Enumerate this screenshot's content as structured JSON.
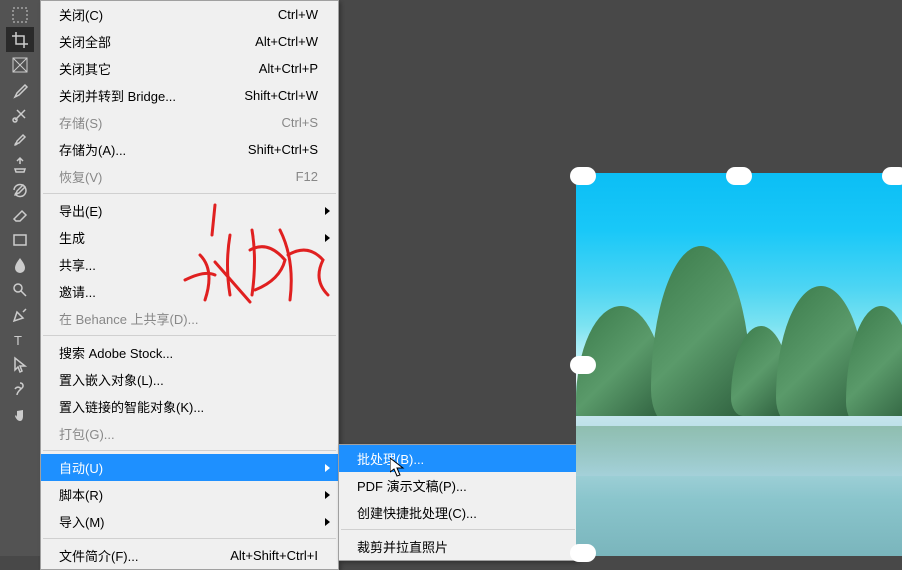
{
  "tools": [
    "marquee",
    "crop",
    "slice",
    "eyedropper",
    "healing",
    "brush",
    "clone",
    "history",
    "eraser",
    "rect",
    "blur",
    "sharpen",
    "pen",
    "type",
    "path",
    "wand",
    "hand"
  ],
  "menu": [
    {
      "label": "关闭(C)",
      "shortcut": "Ctrl+W"
    },
    {
      "label": "关闭全部",
      "shortcut": "Alt+Ctrl+W"
    },
    {
      "label": "关闭其它",
      "shortcut": "Alt+Ctrl+P"
    },
    {
      "label": "关闭并转到 Bridge...",
      "shortcut": "Shift+Ctrl+W"
    },
    {
      "label": "存储(S)",
      "shortcut": "Ctrl+S",
      "dis": true
    },
    {
      "label": "存储为(A)...",
      "shortcut": "Shift+Ctrl+S"
    },
    {
      "label": "恢复(V)",
      "shortcut": "F12",
      "dis": true
    },
    {
      "sep": true
    },
    {
      "label": "导出(E)",
      "sub": true
    },
    {
      "label": "生成",
      "sub": true
    },
    {
      "label": "共享..."
    },
    {
      "label": "邀请..."
    },
    {
      "label": "在 Behance 上共享(D)...",
      "dis": true
    },
    {
      "sep": true
    },
    {
      "label": "搜索 Adobe Stock..."
    },
    {
      "label": "置入嵌入对象(L)..."
    },
    {
      "label": "置入链接的智能对象(K)..."
    },
    {
      "label": "打包(G)...",
      "dis": true
    },
    {
      "sep": true
    },
    {
      "label": "自动(U)",
      "sub": true,
      "hl": true
    },
    {
      "label": "脚本(R)",
      "sub": true
    },
    {
      "label": "导入(M)",
      "sub": true
    },
    {
      "sep": true
    },
    {
      "label": "文件简介(F)...",
      "shortcut": "Alt+Shift+Ctrl+I"
    }
  ],
  "submenu": [
    {
      "label": "批处理(B)...",
      "hl": true
    },
    {
      "label": "PDF 演示文稿(P)..."
    },
    {
      "label": "创建快捷批处理(C)..."
    },
    {
      "sep": true
    },
    {
      "label": "裁剪并拉直照片"
    }
  ]
}
